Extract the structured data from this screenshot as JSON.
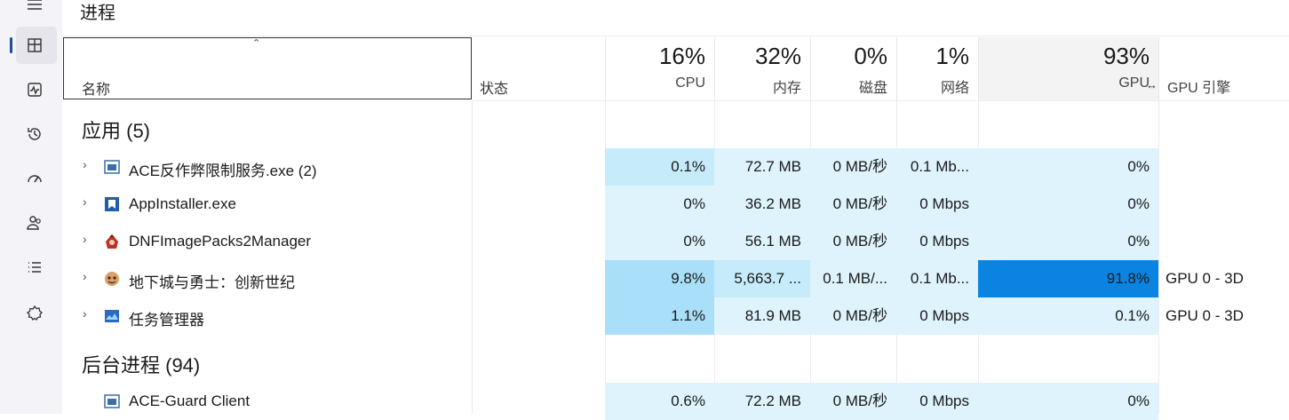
{
  "page": {
    "title": "进程"
  },
  "sidebar": {
    "items": [
      {
        "icon": "hamburger-menu-icon"
      },
      {
        "icon": "processes-icon"
      },
      {
        "icon": "performance-icon"
      },
      {
        "icon": "app-history-icon"
      },
      {
        "icon": "startup-apps-icon"
      },
      {
        "icon": "users-icon"
      },
      {
        "icon": "details-icon"
      },
      {
        "icon": "services-icon"
      }
    ]
  },
  "columns": {
    "name": "名称",
    "status": "状态",
    "cpu": {
      "percent": "16%",
      "label": "CPU"
    },
    "memory": {
      "percent": "32%",
      "label": "内存"
    },
    "disk": {
      "percent": "0%",
      "label": "磁盘"
    },
    "network": {
      "percent": "1%",
      "label": "网络"
    },
    "gpu": {
      "percent": "93%",
      "label": "GPU"
    },
    "gpu_engine": {
      "label": "GPU 引擎"
    }
  },
  "groups": {
    "apps": {
      "title": "应用 (5)"
    },
    "background": {
      "title": "后台进程 (94)"
    }
  },
  "apps": [
    {
      "name": "ACE反作弊限制服务.exe (2)",
      "cpu": "0.1%",
      "memory": "72.7 MB",
      "disk": "0 MB/秒",
      "network": "0.1 Mb...",
      "gpu": "0%",
      "gpu_engine": ""
    },
    {
      "name": "AppInstaller.exe",
      "cpu": "0%",
      "memory": "36.2 MB",
      "disk": "0 MB/秒",
      "network": "0 Mbps",
      "gpu": "0%",
      "gpu_engine": ""
    },
    {
      "name": "DNFImagePacks2Manager",
      "cpu": "0%",
      "memory": "56.1 MB",
      "disk": "0 MB/秒",
      "network": "0 Mbps",
      "gpu": "0%",
      "gpu_engine": ""
    },
    {
      "name": "地下城与勇士：创新世纪",
      "cpu": "9.8%",
      "memory": "5,663.7 ...",
      "disk": "0.1 MB/...",
      "network": "0.1 Mb...",
      "gpu": "91.8%",
      "gpu_engine": "GPU 0 - 3D"
    },
    {
      "name": "任务管理器",
      "cpu": "1.1%",
      "memory": "81.9 MB",
      "disk": "0 MB/秒",
      "network": "0 Mbps",
      "gpu": "0.1%",
      "gpu_engine": "GPU 0 - 3D"
    }
  ],
  "background": [
    {
      "name": "ACE-Guard Client",
      "cpu": "0.6%",
      "memory": "72.2 MB",
      "disk": "0 MB/秒",
      "network": "0 Mbps",
      "gpu": "0%",
      "gpu_engine": ""
    }
  ],
  "colors": {
    "heat_light": "#def3fc",
    "heat_mid": "#c6ebfb",
    "heat_strong": "#a9dff8",
    "heat_max": "#0a84e0",
    "accent": "#1a4fa0"
  }
}
